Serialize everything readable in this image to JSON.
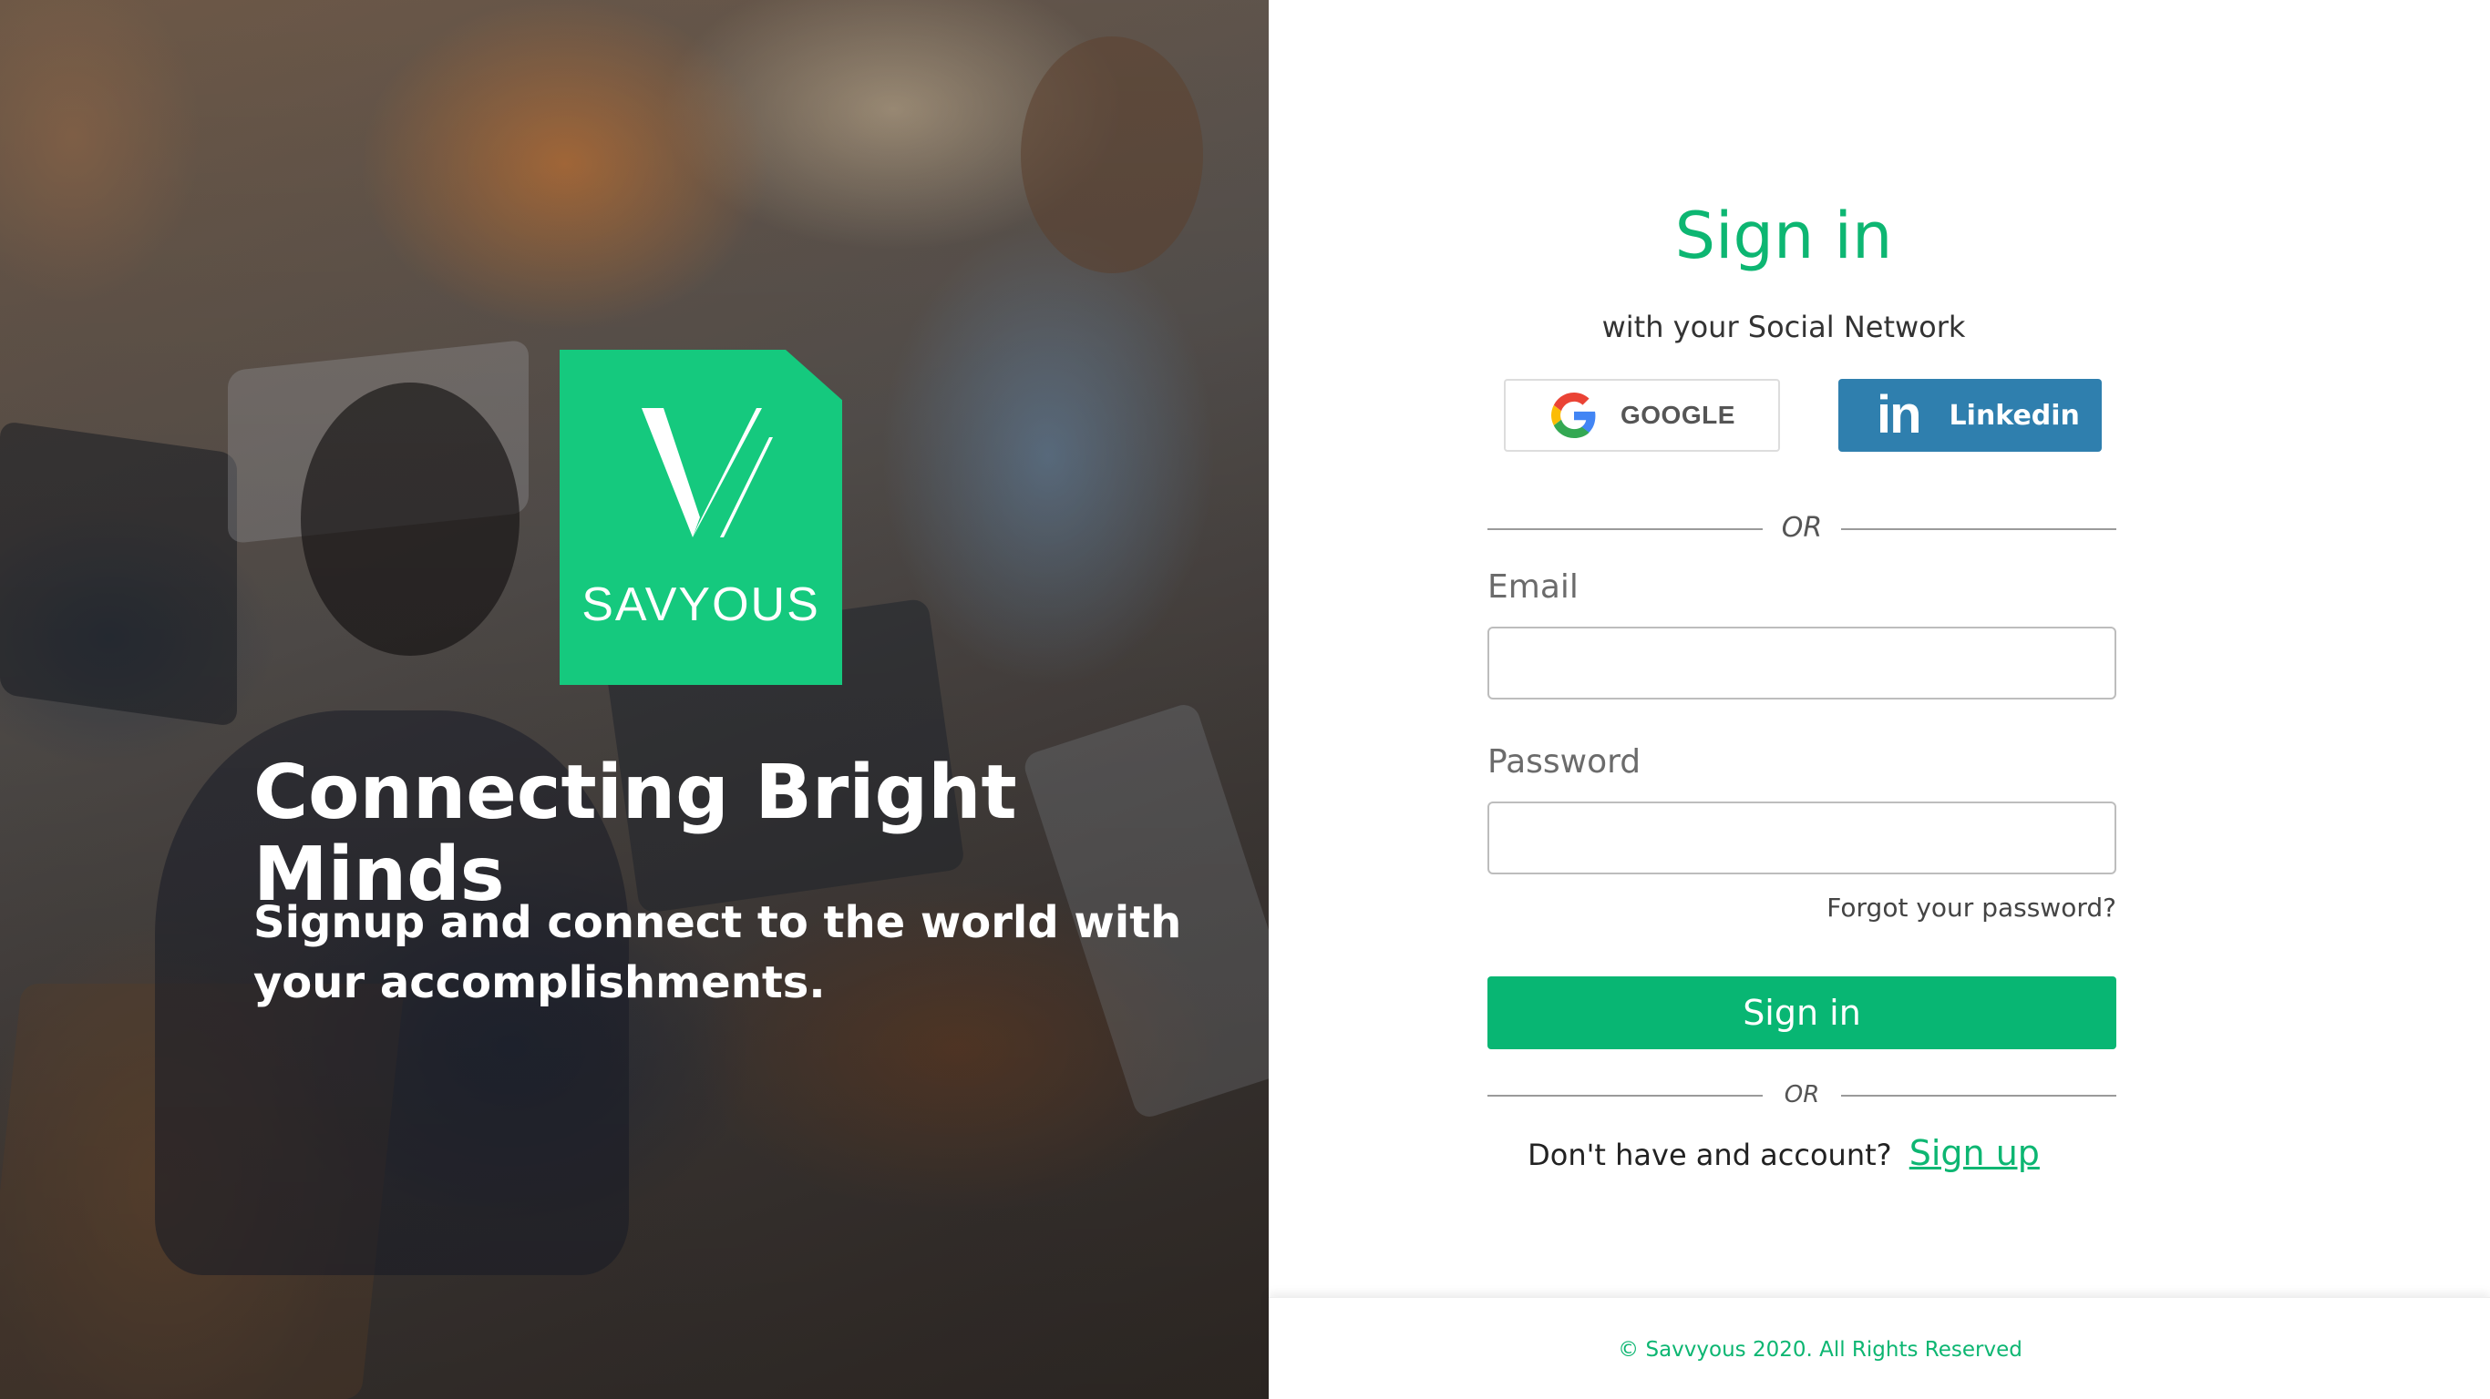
{
  "brand": {
    "logo_word": "SAVYOUS",
    "accent_color": "#0db672",
    "logo_color": "#15c97e"
  },
  "hero": {
    "title": "Connecting Bright Minds",
    "subtitle": "Signup and connect to the world with your accomplishments."
  },
  "signin": {
    "title": "Sign in",
    "social_caption": "with your Social Network",
    "google_label": "GOOGLE",
    "linkedin_label": "Linkedin",
    "linkedin_icon": "in",
    "linkedin_color": "#2f7fae",
    "or_label": "OR",
    "email_label": "Email",
    "email_value": "",
    "password_label": "Password",
    "password_value": "",
    "forgot_label": "Forgot your password?",
    "submit_label": "Sign in",
    "or_label_2": "OR",
    "signup_prompt": "Don't have and account?",
    "signup_link": "Sign up"
  },
  "footer": {
    "copyright": "© Savvyous 2020. All Rights Reserved"
  },
  "icons": {
    "google": "google-g-icon",
    "linkedin": "linkedin-icon",
    "logo": "savvyous-v-logo-icon"
  }
}
